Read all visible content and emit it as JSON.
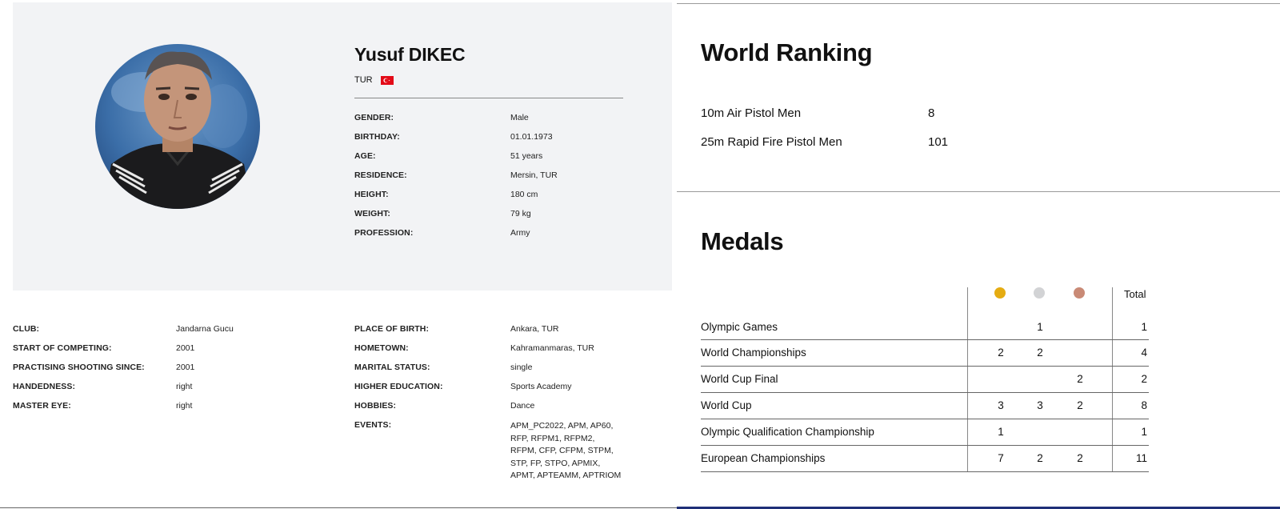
{
  "athlete": {
    "name": "Yusuf DIKEC",
    "country": "TUR",
    "flag_colors": {
      "red": "#e30a17",
      "white": "#ffffff"
    }
  },
  "info": [
    {
      "label": "GENDER:",
      "value": "Male"
    },
    {
      "label": "BIRTHDAY:",
      "value": "01.01.1973"
    },
    {
      "label": "AGE:",
      "value": "51 years"
    },
    {
      "label": "RESIDENCE:",
      "value": "Mersin, TUR"
    },
    {
      "label": "HEIGHT:",
      "value": "180 cm"
    },
    {
      "label": "WEIGHT:",
      "value": "79 kg"
    },
    {
      "label": "PROFESSION:",
      "value": "Army"
    }
  ],
  "details_left": [
    {
      "label": "CLUB:",
      "value": "Jandarna Gucu"
    },
    {
      "label": "START OF COMPETING:",
      "value": "2001"
    },
    {
      "label": "PRACTISING SHOOTING SINCE:",
      "value": "2001"
    },
    {
      "label": "HANDEDNESS:",
      "value": "right"
    },
    {
      "label": "MASTER EYE:",
      "value": "right"
    }
  ],
  "details_right": [
    {
      "label": "PLACE OF BIRTH:",
      "value": "Ankara, TUR"
    },
    {
      "label": "HOMETOWN:",
      "value": "Kahramanmaras, TUR"
    },
    {
      "label": "MARITAL STATUS:",
      "value": "single"
    },
    {
      "label": "HIGHER EDUCATION:",
      "value": "Sports Academy"
    },
    {
      "label": "HOBBIES:",
      "value": "Dance"
    },
    {
      "label": "EVENTS:",
      "value": "APM_PC2022, APM, AP60, RFP, RFPM1, RFPM2, RFPM, CFP, CFPM, STPM, STP, FP, STPO, APMIX, APMT, APTEAMM, APTRIOM"
    }
  ],
  "world_ranking": {
    "title": "World Ranking",
    "entries": [
      {
        "event": "10m Air Pistol Men",
        "rank": "8"
      },
      {
        "event": "25m Rapid Fire Pistol Men",
        "rank": "101"
      }
    ]
  },
  "medals": {
    "title": "Medals",
    "total_label": "Total",
    "medal_colors": {
      "gold": "#e5ac12",
      "silver": "#d2d3d5",
      "bronze": "#c98a76"
    },
    "rows": [
      {
        "name": "Olympic Games",
        "gold": "",
        "silver": "1",
        "bronze": "",
        "total": "1"
      },
      {
        "name": "World Championships",
        "gold": "2",
        "silver": "2",
        "bronze": "",
        "total": "4"
      },
      {
        "name": "World Cup Final",
        "gold": "",
        "silver": "",
        "bronze": "2",
        "total": "2"
      },
      {
        "name": "World Cup",
        "gold": "3",
        "silver": "3",
        "bronze": "2",
        "total": "8"
      },
      {
        "name": "Olympic Qualification Championship",
        "gold": "1",
        "silver": "",
        "bronze": "",
        "total": "1"
      },
      {
        "name": "European Championships",
        "gold": "7",
        "silver": "2",
        "bronze": "2",
        "total": "11"
      }
    ]
  }
}
